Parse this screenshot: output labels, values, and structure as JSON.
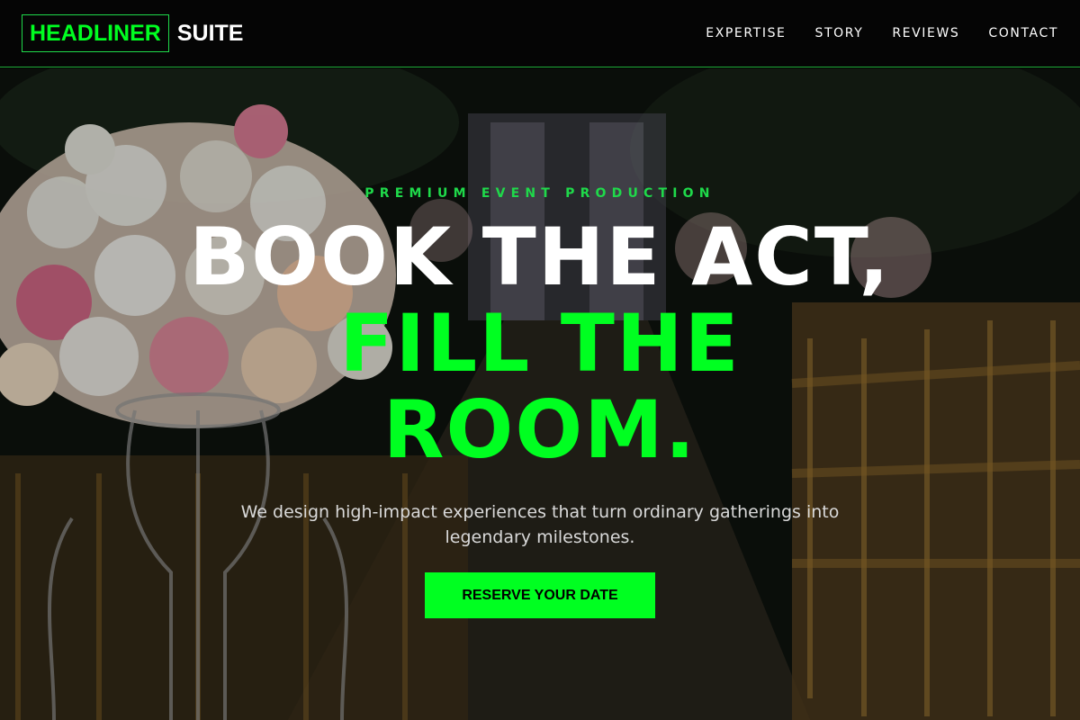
{
  "header": {
    "logo_primary": "HEADLINER",
    "logo_secondary": "SUITE",
    "nav": [
      {
        "label": "EXPERTISE"
      },
      {
        "label": "STORY"
      },
      {
        "label": "REVIEWS"
      },
      {
        "label": "CONTACT"
      }
    ]
  },
  "hero": {
    "eyebrow": "PREMIUM EVENT PRODUCTION",
    "headline_line1": "BOOK THE ACT,",
    "headline_line2": "FILL THE",
    "headline_line3": "ROOM.",
    "lede": "We design high-impact experiences that turn ordinary gatherings into legendary milestones.",
    "cta_label": "RESERVE YOUR DATE",
    "background_image": "wedding-aisle-with-flower-bouquet"
  },
  "colors": {
    "accent": "#00ff21",
    "header_bg": "#050505",
    "header_border": "#1fae3a"
  }
}
